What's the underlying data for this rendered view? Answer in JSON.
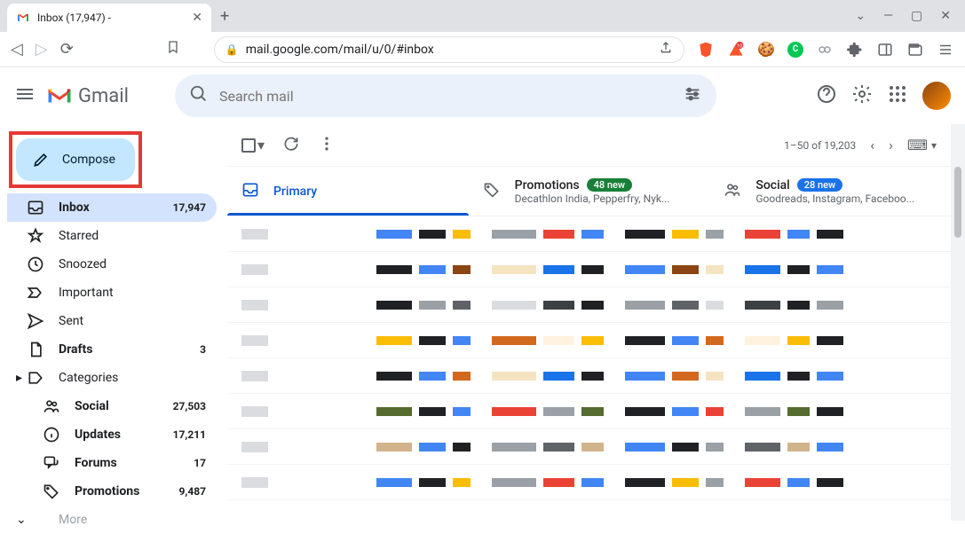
{
  "browser": {
    "tab_title": "Inbox (17,947) - ",
    "url": "mail.google.com/mail/u/0/#inbox"
  },
  "header": {
    "app_name": "Gmail",
    "search_placeholder": "Search mail"
  },
  "compose": {
    "label": "Compose"
  },
  "sidebar": [
    {
      "icon": "inbox",
      "label": "Inbox",
      "count": "17,947",
      "active": true,
      "bold": true
    },
    {
      "icon": "star",
      "label": "Starred"
    },
    {
      "icon": "clock",
      "label": "Snoozed"
    },
    {
      "icon": "important",
      "label": "Important"
    },
    {
      "icon": "send",
      "label": "Sent"
    },
    {
      "icon": "draft",
      "label": "Drafts",
      "count": "3",
      "bold": true
    },
    {
      "icon": "label",
      "label": "Categories",
      "expandable": true
    }
  ],
  "sub_sidebar": [
    {
      "icon": "people",
      "label": "Social",
      "count": "27,503",
      "bold": true
    },
    {
      "icon": "info",
      "label": "Updates",
      "count": "17,211",
      "bold": true
    },
    {
      "icon": "forum",
      "label": "Forums",
      "count": "17",
      "bold": true
    },
    {
      "icon": "tag",
      "label": "Promotions",
      "count": "9,487",
      "bold": true
    }
  ],
  "more_label": "More",
  "toolbar": {
    "page_range": "1–50 of 19,203"
  },
  "category_tabs": [
    {
      "icon": "inbox",
      "label": "Primary",
      "active": true
    },
    {
      "icon": "tag",
      "label": "Promotions",
      "badge": "48 new",
      "badge_color": "green",
      "subtitle": "Decathlon India, Pepperfry, Nyk..."
    },
    {
      "icon": "people",
      "label": "Social",
      "badge": "28 new",
      "badge_color": "blue",
      "subtitle": "Goodreads, Instagram, Faceboo..."
    }
  ]
}
